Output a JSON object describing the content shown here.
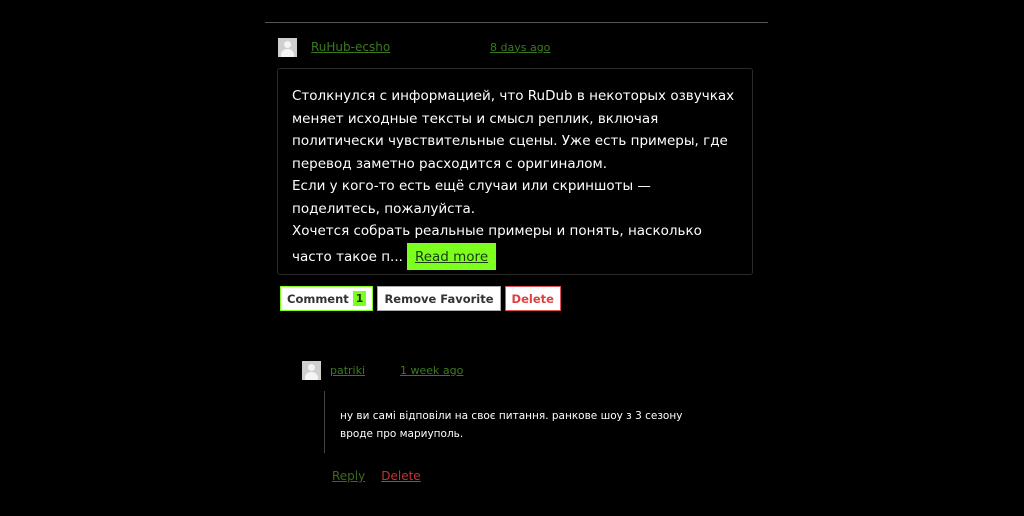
{
  "post": {
    "author": "RuHub-ecsho",
    "time": "8 days ago",
    "paragraphs": [
      "Столкнулся с информацией, что RuDub в некоторых озвучках меняет исходные тексты и смысл реплик, включая политически чувствительные сцены. Уже есть примеры, где перевод заметно расходится с оригиналом.",
      "Если у кого-то есть ещё случаи или скриншоты — поделитесь, пожалуйста.",
      "Хочется собрать реальные примеры и понять, насколько часто такое п..."
    ],
    "read_more_label": "Read more"
  },
  "actions": {
    "comment_label": "Comment",
    "comment_count": "1",
    "remove_favorite_label": "Remove Favorite",
    "delete_label": "Delete"
  },
  "reply": {
    "author": "patriki",
    "time": "1 week ago",
    "text": "ну ви самі відповіли на своє питання. ранкове шоу з 3 сезону вроде про мариуполь.",
    "reply_label": "Reply",
    "delete_label": "Delete"
  },
  "colors": {
    "background": "#000000",
    "accent_green": "#7cff1e",
    "link_green": "#3a7a1f",
    "delete_red": "#e04040"
  }
}
